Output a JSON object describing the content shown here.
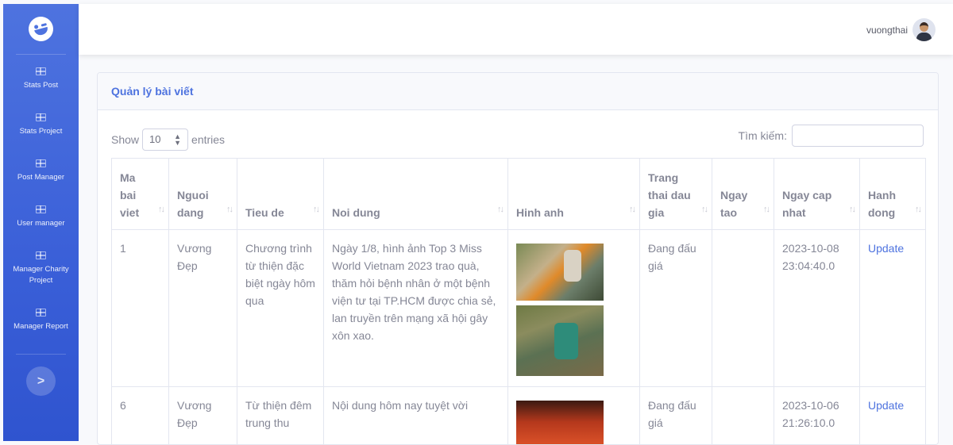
{
  "sidebar": {
    "items": [
      {
        "label": "Stats Post"
      },
      {
        "label": "Stats Project"
      },
      {
        "label": "Post Manager"
      },
      {
        "label": "User manager"
      },
      {
        "label": "Manager Charity Project"
      },
      {
        "label": "Manager Report"
      }
    ],
    "toggle_icon": ">"
  },
  "topbar": {
    "user_name": "vuongthai"
  },
  "card": {
    "title": "Quản lý bài viết"
  },
  "controls": {
    "show_label": "Show",
    "entries_value": "10",
    "entries_label": "entries",
    "search_label": "Tìm kiếm:"
  },
  "table": {
    "headers": [
      "Ma bai viet",
      "Nguoi dang",
      "Tieu de",
      "Noi dung",
      "Hinh anh",
      "Trang thai dau gia",
      "Ngay tao",
      "Ngay cap nhat",
      "Hanh dong"
    ],
    "rows": [
      {
        "id": "1",
        "author": "Vương Đẹp",
        "title": "Chương trình từ thiện đặc biệt ngày hôm qua",
        "content": "Ngày 1/8, hình ảnh Top 3 Miss World Vietnam 2023 trao quà, thăm hỏi bệnh nhân ở một bệnh viện tư tại TP.HCM được chia sẻ, lan truyền trên mạng xã hội gây xôn xao.",
        "status": "Đang đấu giá",
        "created": "",
        "updated": "2023-10-08 23:04:40.0",
        "action": "Update"
      },
      {
        "id": "6",
        "author": "Vương Đẹp",
        "title": "Từ thiện đêm trung thu",
        "content": "Nội dung hôm nay tuyệt vời",
        "status": "Đang đấu giá",
        "created": "",
        "updated": "2023-10-06 21:26:10.0",
        "action": "Update"
      }
    ]
  },
  "colors": {
    "primary": "#4e73df",
    "text": "#858796",
    "border": "#e3e6f0"
  }
}
